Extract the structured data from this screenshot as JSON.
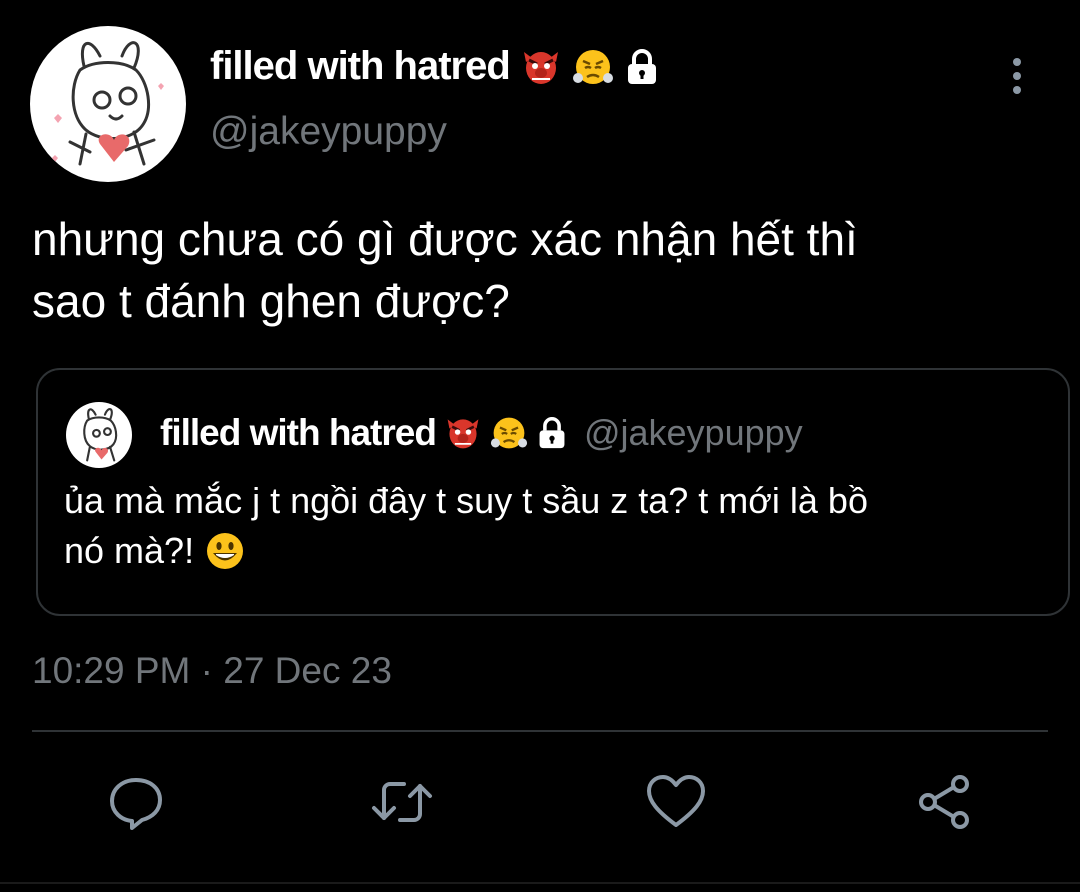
{
  "author": {
    "display_name": "filled with hatred",
    "handle": "@jakeypuppy",
    "badges": [
      "goblin-emoji",
      "steam-face-emoji",
      "lock-icon"
    ]
  },
  "tweet": {
    "text_line1": "nhưng chưa có gì được xác nhận hết thì",
    "text_line2": "sao t đánh ghen được?"
  },
  "quoted_tweet": {
    "display_name": "filled with hatred",
    "handle": "@jakeypuppy",
    "text_line1": "ủa mà mắc j t ngồi đây t suy t sầu z ta? t mới là bồ",
    "text_line2": "nó mà?!"
  },
  "timestamp": "10:29 PM · 27 Dec 23",
  "actions": [
    "reply-icon",
    "retweet-icon",
    "like-icon",
    "share-icon"
  ],
  "colors": {
    "background": "#000000",
    "text_primary": "#ffffff",
    "text_secondary": "#71767b",
    "border": "#2f3336"
  }
}
